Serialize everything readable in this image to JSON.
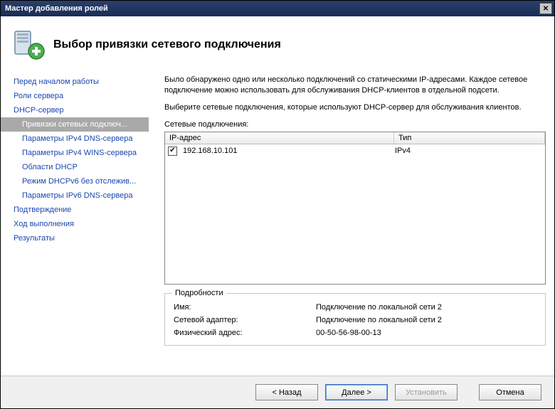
{
  "window": {
    "title": "Мастер добавления ролей"
  },
  "header": {
    "title": "Выбор привязки сетевого подключения"
  },
  "sidebar": {
    "items": [
      {
        "label": "Перед началом работы",
        "indent": 0
      },
      {
        "label": "Роли сервера",
        "indent": 0
      },
      {
        "label": "DHCP-сервер",
        "indent": 0
      },
      {
        "label": "Привязки сетевых подключ...",
        "indent": 1,
        "selected": true
      },
      {
        "label": "Параметры IPv4 DNS-сервера",
        "indent": 1
      },
      {
        "label": "Параметры IPv4 WINS-сервера",
        "indent": 1
      },
      {
        "label": "Области DHCP",
        "indent": 1
      },
      {
        "label": "Режим DHCPv6 без отслежив...",
        "indent": 1
      },
      {
        "label": "Параметры IPv6 DNS-сервера",
        "indent": 1
      },
      {
        "label": "Подтверждение",
        "indent": 0
      },
      {
        "label": "Ход выполнения",
        "indent": 0
      },
      {
        "label": "Результаты",
        "indent": 0
      }
    ]
  },
  "main": {
    "intro": "Было обнаружено одно или несколько подключений со статическими IP-адресами. Каждое сетевое подключение можно использовать для обслуживания DHCP-клиентов в отдельной подсети.",
    "instruction": "Выберите сетевые подключения, которые используют DHCP-сервер для обслуживания клиентов.",
    "connections_label": "Сетевые подключения:",
    "columns": {
      "ip": "IP-адрес",
      "type": "Тип"
    },
    "rows": [
      {
        "checked": true,
        "ip": "192.168.10.101",
        "type": "IPv4"
      }
    ],
    "details": {
      "legend": "Подробности",
      "name_label": "Имя:",
      "name_value": "Подключение по локальной сети 2",
      "adapter_label": "Сетевой адаптер:",
      "adapter_value": "Подключение по локальной сети 2",
      "mac_label": "Физический адрес:",
      "mac_value": "00-50-56-98-00-13"
    }
  },
  "buttons": {
    "back": "< Назад",
    "next": "Далее >",
    "install": "Установить",
    "cancel": "Отмена"
  }
}
